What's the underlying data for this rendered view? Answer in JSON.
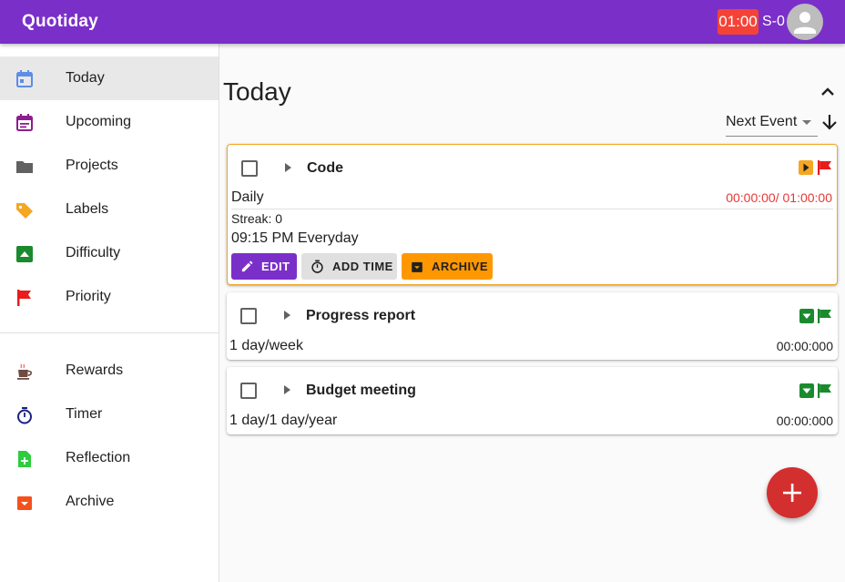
{
  "app": {
    "title": "Quotiday",
    "timer": "01:00",
    "streak": "S-0"
  },
  "sidebar": {
    "items": [
      {
        "label": "Today",
        "icon": "calendar-today-icon",
        "color": "#5c8de8"
      },
      {
        "label": "Upcoming",
        "icon": "calendar-month-icon",
        "color": "#8e1d8e"
      },
      {
        "label": "Projects",
        "icon": "folder-icon",
        "color": "#616161"
      },
      {
        "label": "Labels",
        "icon": "tag-icon",
        "color": "#f5a623"
      },
      {
        "label": "Difficulty",
        "icon": "difficulty-icon",
        "color": "#1b8a2e"
      },
      {
        "label": "Priority",
        "icon": "flag-icon",
        "color": "#e81c1c"
      },
      {
        "label": "Rewards",
        "icon": "coffee-icon",
        "color": "#6d4c41"
      },
      {
        "label": "Timer",
        "icon": "timer-icon",
        "color": "#1a237e"
      },
      {
        "label": "Reflection",
        "icon": "note-add-icon",
        "color": "#2ecc40"
      },
      {
        "label": "Archive",
        "icon": "archive-icon",
        "color": "#f4511e"
      }
    ]
  },
  "main": {
    "title": "Today",
    "sort": {
      "value": "Next Event"
    }
  },
  "tasks": [
    {
      "name": "Code",
      "frequency": "Daily",
      "time": "00:00:00/ 01:00:00",
      "streak": "Streak: 0",
      "schedule": "09:15 PM Everyday",
      "actions": {
        "edit": "EDIT",
        "add_time": "ADD TIME",
        "archive": "ARCHIVE"
      },
      "difficulty_color": "#f5a623",
      "priority_color": "#e81c1c"
    },
    {
      "name": "Progress report",
      "frequency": "1 day/week",
      "time": "00:00:000",
      "difficulty_color": "#1b8a2e",
      "priority_color": "#1b8a2e"
    },
    {
      "name": "Budget meeting",
      "frequency": "1 day/1 day/year",
      "time": "00:00:000",
      "difficulty_color": "#1b8a2e",
      "priority_color": "#1b8a2e"
    }
  ],
  "colors": {
    "appbar": "#7b2fc9",
    "edit_button": "#7b2fc9",
    "add_time_button": "#e0e0e0",
    "archive_button": "#ff9800",
    "fab": "#d32f2f",
    "overdue_time": "#e53935"
  }
}
